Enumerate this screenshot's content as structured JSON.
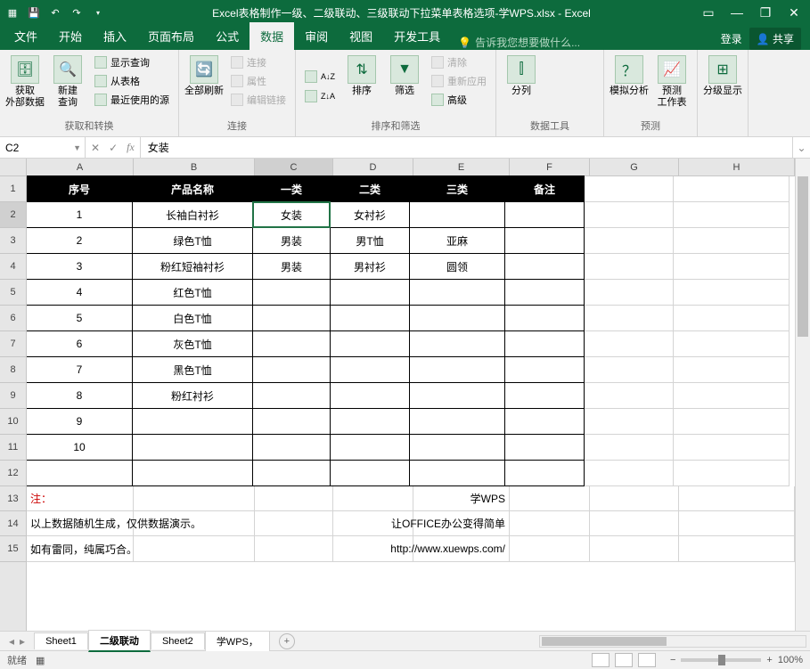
{
  "titlebar": {
    "title": "Excel表格制作一级、二级联动、三级联动下拉菜单表格选项-学WPS.xlsx - Excel"
  },
  "wcontrols": {
    "opts": "▭",
    "min": "—",
    "max": "❐",
    "close": "✕"
  },
  "tabs": {
    "items": [
      "文件",
      "开始",
      "插入",
      "页面布局",
      "公式",
      "数据",
      "审阅",
      "视图",
      "开发工具"
    ],
    "active": 5,
    "tellme": "告诉我您想要做什么...",
    "login": "登录",
    "share": "共享"
  },
  "ribbon": {
    "g1": {
      "label": "获取和转换",
      "btn1": "获取\n外部数据",
      "btn2": "新建\n查询",
      "s1": "显示查询",
      "s2": "从表格",
      "s3": "最近使用的源"
    },
    "g2": {
      "label": "连接",
      "btn1": "全部刷新",
      "s1": "连接",
      "s2": "属性",
      "s3": "编辑链接"
    },
    "g3": {
      "label": "排序和筛选",
      "btnA": "A↓Z",
      "btnZ": "Z↓A",
      "btnS": "排序",
      "btnF": "筛选",
      "s1": "清除",
      "s2": "重新应用",
      "s3": "高级"
    },
    "g4": {
      "label": "数据工具",
      "btn1": "分列"
    },
    "g5": {
      "label": "预测",
      "btn1": "模拟分析",
      "btn2": "预测\n工作表"
    },
    "g6": {
      "label": "",
      "btn1": "分级显示"
    }
  },
  "fbar": {
    "name": "C2",
    "value": "女装"
  },
  "grid": {
    "cols": [
      "A",
      "B",
      "C",
      "D",
      "E",
      "F",
      "G",
      "H"
    ],
    "headers": [
      "序号",
      "产品名称",
      "一类",
      "二类",
      "三类",
      "备注"
    ],
    "rows": [
      {
        "n": "1",
        "b": "长袖白衬衫",
        "c": "女装",
        "d": "女衬衫",
        "e": "",
        "f": ""
      },
      {
        "n": "2",
        "b": "绿色T恤",
        "c": "男装",
        "d": "男T恤",
        "e": "亚麻",
        "f": ""
      },
      {
        "n": "3",
        "b": "粉红短袖衬衫",
        "c": "男装",
        "d": "男衬衫",
        "e": "圆领",
        "f": ""
      },
      {
        "n": "4",
        "b": "红色T恤",
        "c": "",
        "d": "",
        "e": "",
        "f": ""
      },
      {
        "n": "5",
        "b": "白色T恤",
        "c": "",
        "d": "",
        "e": "",
        "f": ""
      },
      {
        "n": "6",
        "b": "灰色T恤",
        "c": "",
        "d": "",
        "e": "",
        "f": ""
      },
      {
        "n": "7",
        "b": "黑色T恤",
        "c": "",
        "d": "",
        "e": "",
        "f": ""
      },
      {
        "n": "8",
        "b": "粉红衬衫",
        "c": "",
        "d": "",
        "e": "",
        "f": ""
      },
      {
        "n": "9",
        "b": "",
        "c": "",
        "d": "",
        "e": "",
        "f": ""
      },
      {
        "n": "10",
        "b": "",
        "c": "",
        "d": "",
        "e": "",
        "f": ""
      }
    ],
    "note_title": "注：",
    "note_l1": "以上数据随机生成，仅供数据演示。",
    "note_l2": "如有雷同，纯属巧合。",
    "brand1": "学WPS",
    "brand2": "让OFFICE办公变得简单",
    "brand3": "http://www.xuewps.com/",
    "active_display": "女装"
  },
  "sheets": {
    "items": [
      "Sheet1",
      "二级联动",
      "Sheet2",
      "学WPS，"
    ],
    "active": 1
  },
  "status": {
    "ready": "就绪",
    "zoom": "100%"
  }
}
